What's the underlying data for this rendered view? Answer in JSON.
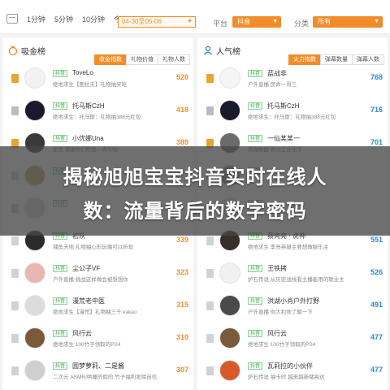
{
  "filters": {
    "time_options": [
      "1分钟",
      "5分钟",
      "10分钟",
      "今天"
    ],
    "date_range": "04-30至05-06",
    "platform_label": "平台",
    "platform_value": "抖音",
    "category_label": "分类",
    "category_value": "所有"
  },
  "left_panel": {
    "title": "吸金榜",
    "tabs": [
      "收金指数",
      "礼物价值",
      "礼物人数"
    ],
    "active_tab": 0,
    "rows": [
      {
        "badge": "抖音",
        "name": "ToveLo",
        "desc": "绝地求生【图拉夫】礼物抽奖轮",
        "score": "520",
        "rank": "gold",
        "avatar_color": "#f2f2f2"
      },
      {
        "badge": "抖音",
        "name": "托马斯CzH",
        "desc": "绝地求生：托马斯：礼物抽388元红包",
        "score": "418",
        "rank": "silver",
        "avatar_color": "#1a1a2e"
      },
      {
        "badge": "抖音",
        "name": "小优娜Una",
        "desc": "星夜 谢谢你们陪我一周年啦~",
        "score": "389",
        "rank": "gold",
        "avatar_color": "#3a3a3a"
      },
      {
        "badge": "抖音",
        "name": "",
        "desc": "",
        "score": "",
        "rank": "plain",
        "avatar_color": "#c9a86a"
      },
      {
        "badge": "抖音",
        "name": "",
        "desc": "",
        "score": "",
        "rank": "plain",
        "avatar_color": "#d7d7d7"
      },
      {
        "badge": "抖音",
        "name": "初队",
        "desc": "捕鱼天地 礼物抽心形玩偶可以折现",
        "score": "339",
        "rank": "plain",
        "avatar_color": "#2b2b2b"
      },
      {
        "badge": "抖音",
        "name": "尘公子VF",
        "desc": "户外直播 挑战这样做会被想想你",
        "score": "323",
        "rank": "plain",
        "avatar_color": "#e7b7b0"
      },
      {
        "badge": "抖音",
        "name": "漫荒老中医",
        "desc": "绝地求生【漫荒】礼物抽三千 kakao",
        "score": "315",
        "rank": "plain",
        "avatar_color": "#dcdcdc"
      },
      {
        "badge": "抖音",
        "name": "风行云",
        "desc": "绝地求生 100竹子领取的PS4",
        "score": "310",
        "rank": "plain",
        "avatar_color": "#7a5a3a"
      },
      {
        "badge": "抖音",
        "name": "圆梦萝莉、二是酱",
        "desc": "二次元 ASMR/哄睡的假的 竹子福利发挥自信",
        "score": "307",
        "rank": "plain",
        "avatar_color": "#cfcfcf"
      }
    ]
  },
  "right_panel": {
    "title": "人气榜",
    "tabs": [
      "火力指数",
      "弹幕数量",
      "弹幕人数"
    ],
    "active_tab": 0,
    "rows": [
      {
        "badge": "抖音",
        "name": "蓝战非",
        "desc": "户外直播 民命一哥三",
        "score": "768",
        "rank": "gold",
        "avatar_color": "#f5f5f5"
      },
      {
        "badge": "抖音",
        "name": "托马斯CzH",
        "desc": "绝地求生：托马斯：礼物抽388元红包",
        "score": "716",
        "rank": "silver",
        "avatar_color": "#1a1a2e"
      },
      {
        "badge": "抖音",
        "name": "一仙某某一",
        "desc": "英雄联盟 新兴工业化下",
        "score": "701",
        "rank": "gold",
        "avatar_color": "#6b6b6b"
      },
      {
        "badge": "抖音",
        "name": "",
        "desc": "",
        "score": "",
        "rank": "plain",
        "avatar_color": "#9a8f8a"
      },
      {
        "badge": "抖音",
        "name": "",
        "desc": "",
        "score": "",
        "rank": "plain",
        "avatar_color": "#d9d9d9"
      },
      {
        "badge": "抖音",
        "name": "蔡亮亮 - 虎神",
        "desc": "绝地求生 李亮英雄主要想做娱乐主",
        "score": "551",
        "rank": "plain",
        "avatar_color": "#3a2e2a"
      },
      {
        "badge": "抖音",
        "name": "王铁拷",
        "desc": "炉石传说 从历史战线看主播能用的歌业主",
        "score": "526",
        "rank": "plain",
        "avatar_color": "#f0f0f0"
      },
      {
        "badge": "抖音",
        "name": "洪湖小肖户外打野",
        "desc": "户外直播 你大利地了解一下",
        "score": "491",
        "rank": "plain",
        "avatar_color": "#4a4a4a"
      },
      {
        "badge": "抖音",
        "name": "风行云",
        "desc": "绝地求生 100竹子领取的PS4",
        "score": "477",
        "rank": "plain",
        "avatar_color": "#7a5a3a"
      },
      {
        "badge": "抖音",
        "name": "瓦莉拉的小伙伴",
        "desc": "炉石传说 抽卡时 越来越新赌高达",
        "score": "477",
        "rank": "plain",
        "avatar_color": "#d65a2a"
      }
    ]
  },
  "overlay": {
    "line1": "揭秘旭旭宝宝抖音实时在线人",
    "line2": "数：流量背后的数字密码"
  },
  "colors": {
    "accent": "#f28c28",
    "score_left": "#f28c28",
    "score_right": "#2a89d8",
    "badge_green": "#4caf50"
  }
}
